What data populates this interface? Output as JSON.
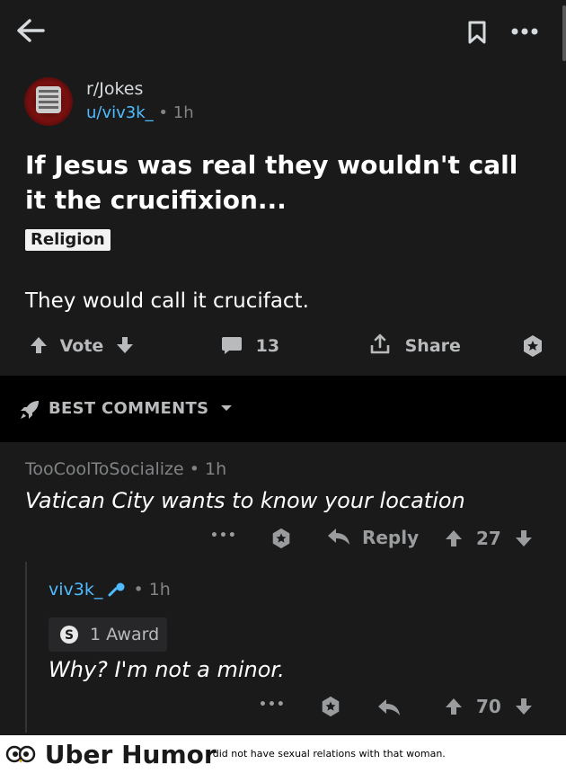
{
  "header": {
    "back_icon": "arrow-left-icon",
    "save_icon": "bookmark-icon",
    "more_icon": "more-icon"
  },
  "post": {
    "subreddit": "r/Jokes",
    "author": "u/viv3k_",
    "separator": "•",
    "time": "1h",
    "title": "If Jesus was real they wouldn't call it the crucifixion...",
    "flair": "Religion",
    "body": "They would call it crucifact.",
    "actions": {
      "vote_label": "Vote",
      "comment_count": "13",
      "share_label": "Share"
    }
  },
  "sort": {
    "label": "BEST COMMENTS"
  },
  "comments": [
    {
      "author": "TooCoolToSocialize",
      "separator": "•",
      "time": "1h",
      "body": "Vatican City wants to know your location",
      "more": "•••",
      "reply_label": "Reply",
      "score": "27"
    },
    {
      "author": "viv3k_",
      "separator": "•",
      "time": "1h",
      "award_label": "1 Award",
      "body": "Why? I'm not a minor.",
      "more": "•••",
      "score": "70"
    }
  ],
  "footer": {
    "brand": "Uber Humor",
    "tagline": "I did not have sexual relations with that woman."
  },
  "colors": {
    "background": "#1a1a1b",
    "accent_blue": "#4fbcff",
    "text": "#d7dadc"
  }
}
